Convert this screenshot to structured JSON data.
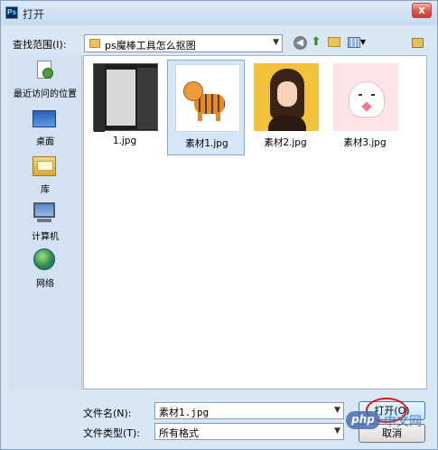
{
  "window": {
    "app_icon_text": "Ps",
    "title": "打开",
    "close_label": "x"
  },
  "toolbar": {
    "lookin_label": "查找范围(I):",
    "lookin_value": "ps魔棒工具怎么抠图",
    "back_icon": "back-arrow-icon",
    "up_icon": "up-folder-icon",
    "new_folder_icon": "new-folder-icon",
    "view_menu_icon": "view-menu-icon"
  },
  "places": [
    {
      "label": "最近访问的位置",
      "icon": "recent-places-icon"
    },
    {
      "label": "桌面",
      "icon": "desktop-icon"
    },
    {
      "label": "库",
      "icon": "library-icon"
    },
    {
      "label": "计算机",
      "icon": "computer-icon"
    },
    {
      "label": "网络",
      "icon": "network-icon"
    }
  ],
  "files": [
    {
      "name": "1.jpg",
      "selected": false
    },
    {
      "name": "素材1.jpg",
      "selected": true
    },
    {
      "name": "素材2.jpg",
      "selected": false
    },
    {
      "name": "素材3.jpg",
      "selected": false
    }
  ],
  "footer": {
    "filename_label": "文件名(N):",
    "filename_value": "素材1.jpg",
    "filetype_label": "文件类型(T):",
    "filetype_value": "所有格式",
    "open_button": "打开(O)",
    "cancel_button": "取消"
  },
  "watermark": {
    "logo": "php",
    "text": "中文网"
  },
  "colors": {
    "dialog_background": "#d9e6f4",
    "selection_fill": "#d5e6f8",
    "annotation_circle": "#d01a1a"
  }
}
